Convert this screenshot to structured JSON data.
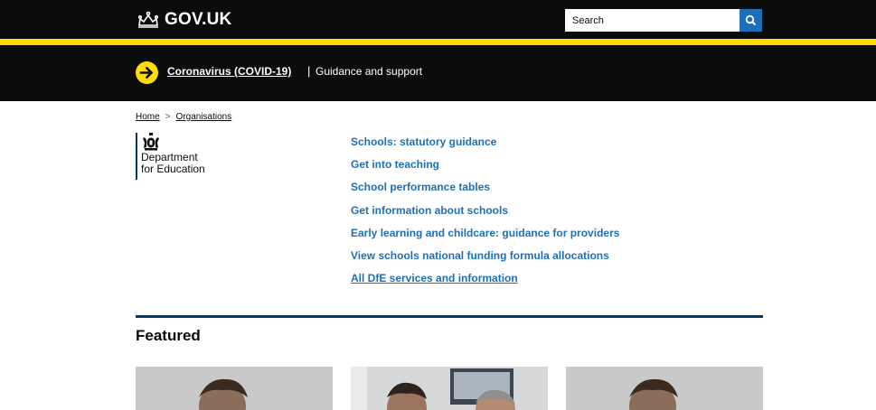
{
  "header": {
    "logo_text": "GOV.UK",
    "search_placeholder": "Search",
    "search_icon": "search-icon"
  },
  "covid_banner": {
    "link_text": "Coronavirus (COVID-19)",
    "separator": "|",
    "text": "Guidance and support",
    "icon": "arrow-right-circle-icon"
  },
  "breadcrumb": {
    "items": [
      "Home",
      "Organisations"
    ],
    "separator_icon": "chevron-right-icon"
  },
  "organisation": {
    "name_line1": "Department",
    "name_line2": "for Education",
    "icon": "royal-crest-icon"
  },
  "links": [
    "Schools: statutory guidance",
    "Get into teaching",
    "School performance tables",
    "Get information about schools",
    "Early learning and childcare: guidance for providers",
    "View schools national funding formula allocations",
    "All DfE services and information"
  ],
  "featured": {
    "heading": "Featured",
    "cards": [
      {
        "image": "featured-image-1"
      },
      {
        "image": "featured-image-2"
      },
      {
        "image": "featured-image-3"
      }
    ]
  },
  "colors": {
    "header_bg": "#0b0c0c",
    "accent_yellow": "#ffdd00",
    "link_blue": "#1d70b8",
    "dfe_rule": "#003a69"
  }
}
